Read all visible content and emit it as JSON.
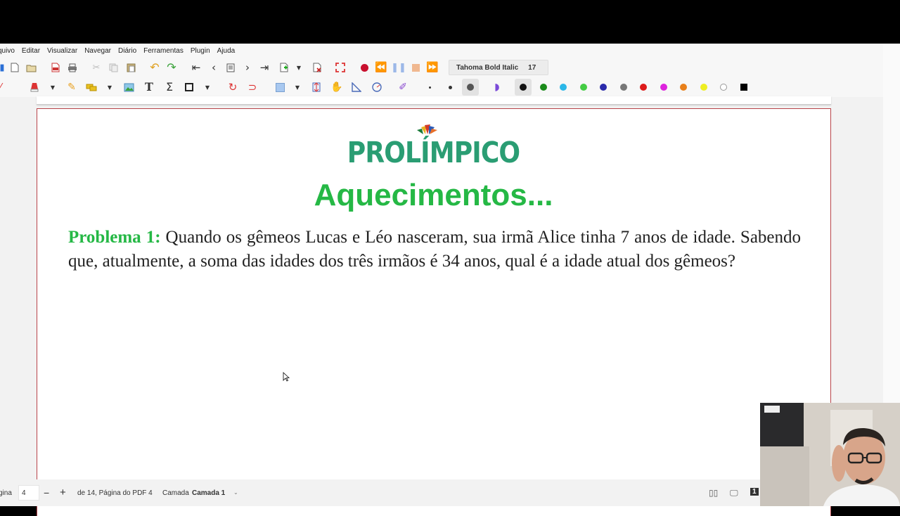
{
  "menu": [
    "quivo",
    "Editar",
    "Visualizar",
    "Navegar",
    "Diário",
    "Ferramentas",
    "Plugin",
    "Ajuda"
  ],
  "toolbar": {
    "font_name": "Tahoma Bold Italic",
    "font_size": "17"
  },
  "colors": {
    "swatches": [
      "#111111",
      "#1a8a1a",
      "#2bb7e8",
      "#44cc44",
      "#2a2aaa",
      "#777777",
      "#dd1a1a",
      "#dd22dd",
      "#e8801a",
      "#eeee22",
      "#ffffff",
      "#000000"
    ],
    "logo_green": "#2a9d73",
    "heading_green": "#25b845",
    "page_border": "#b8444a"
  },
  "document": {
    "logo": "PROLÍMPICO",
    "heading": "Aquecimentos...",
    "problem_label": "Problema 1:",
    "problem_text": "Quando os gêmeos Lucas e Léo nasceram, sua irmã Alice tinha 7 anos de idade. Sabendo que, atualmente, a soma das idades dos três irmãos é 34 anos, qual é a idade atual dos gêmeos?"
  },
  "status": {
    "page_label": "gina",
    "page_value": "4",
    "page_info": "de 14, Página do PDF 4",
    "layer_label": "Camada",
    "layer_value": "Camada 1",
    "page_badge": "1"
  }
}
